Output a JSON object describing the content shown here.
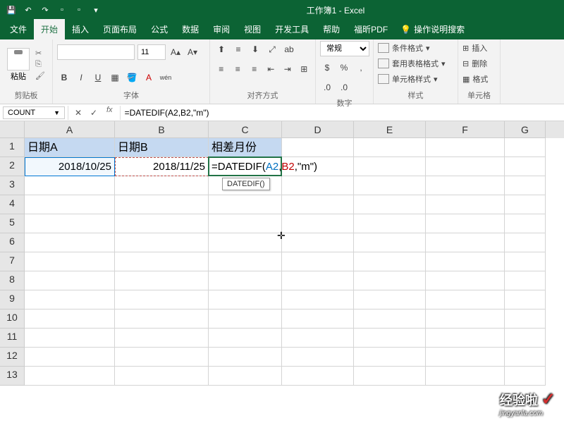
{
  "title": "工作簿1 - Excel",
  "tabs": {
    "file": "文件",
    "home": "开始",
    "insert": "插入",
    "layout": "页面布局",
    "formulas": "公式",
    "data": "数据",
    "review": "审阅",
    "view": "视图",
    "dev": "开发工具",
    "help": "帮助",
    "pdf": "福昕PDF",
    "tellme": "操作说明搜索"
  },
  "ribbon": {
    "clipboard": {
      "label": "剪贴板",
      "paste": "粘贴"
    },
    "font": {
      "label": "字体",
      "size": "11",
      "bold": "B",
      "italic": "I",
      "underline": "U"
    },
    "align": {
      "label": "对齐方式"
    },
    "number": {
      "label": "数字",
      "format": "常规"
    },
    "styles": {
      "label": "样式",
      "cond": "条件格式",
      "table": "套用表格格式",
      "cell": "单元格样式"
    },
    "cells": {
      "label": "单元格",
      "insert": "插入",
      "delete": "删除",
      "format": "格式"
    }
  },
  "namebox": "COUNT",
  "formula": "=DATEDIF(A2,B2,\"m\")",
  "formula_tooltip": "DATEDIF()",
  "columns": [
    "A",
    "B",
    "C",
    "D",
    "E",
    "F",
    "G"
  ],
  "rows": [
    "1",
    "2",
    "3",
    "4",
    "5",
    "6",
    "7",
    "8",
    "9",
    "10",
    "11",
    "12",
    "13"
  ],
  "sheet": {
    "A1": "日期A",
    "B1": "日期B",
    "C1": "相差月份",
    "A2": "2018/10/25",
    "B2": "2018/11/25",
    "C2_pre": "=DATE",
    "C2_post": "DIF(",
    "C2_ref1": "A2",
    "C2_comma": ",",
    "C2_ref2": "B2",
    "C2_rest": ",\"m\")"
  },
  "watermark": {
    "text": "经验啦",
    "sub": "jingyanla.com"
  },
  "chart_data": {
    "type": "table",
    "title": "",
    "columns": [
      "日期A",
      "日期B",
      "相差月份"
    ],
    "rows": [
      [
        "2018/10/25",
        "2018/11/25",
        "=DATEDIF(A2,B2,\"m\")"
      ]
    ]
  }
}
